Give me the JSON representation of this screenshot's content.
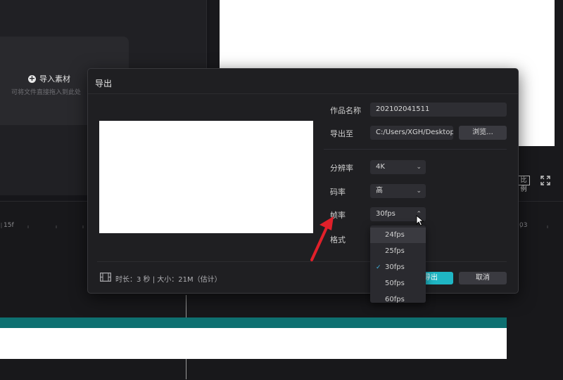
{
  "media_panel": {
    "import_label": "导入素材",
    "import_hint": "可将文件直接拖入到此处"
  },
  "player": {
    "ratio_label": "比例"
  },
  "timeline": {
    "ticks": [
      "15f",
      "03"
    ]
  },
  "dialog": {
    "title": "导出",
    "fields": {
      "name_label": "作品名称",
      "name_value": "202102041511",
      "path_label": "导出至",
      "path_value": "C:/Users/XGH/Desktop",
      "browse_label": "浏览...",
      "resolution_label": "分辨率",
      "resolution_value": "4K",
      "bitrate_label": "码率",
      "bitrate_value": "高",
      "fps_label": "帧率",
      "fps_value": "30fps",
      "format_label": "格式"
    },
    "footer": {
      "info": "时长：3 秒 | 大小：21M（估计）",
      "export_label": "导出",
      "cancel_label": "取消"
    },
    "fps_menu": {
      "options": [
        "24fps",
        "25fps",
        "30fps",
        "50fps",
        "60fps"
      ],
      "selected": "30fps",
      "highlighted": "24fps"
    }
  },
  "colors": {
    "accent": "#1fb6c4",
    "annotation": "#e0202a",
    "track": "#0e7071"
  }
}
